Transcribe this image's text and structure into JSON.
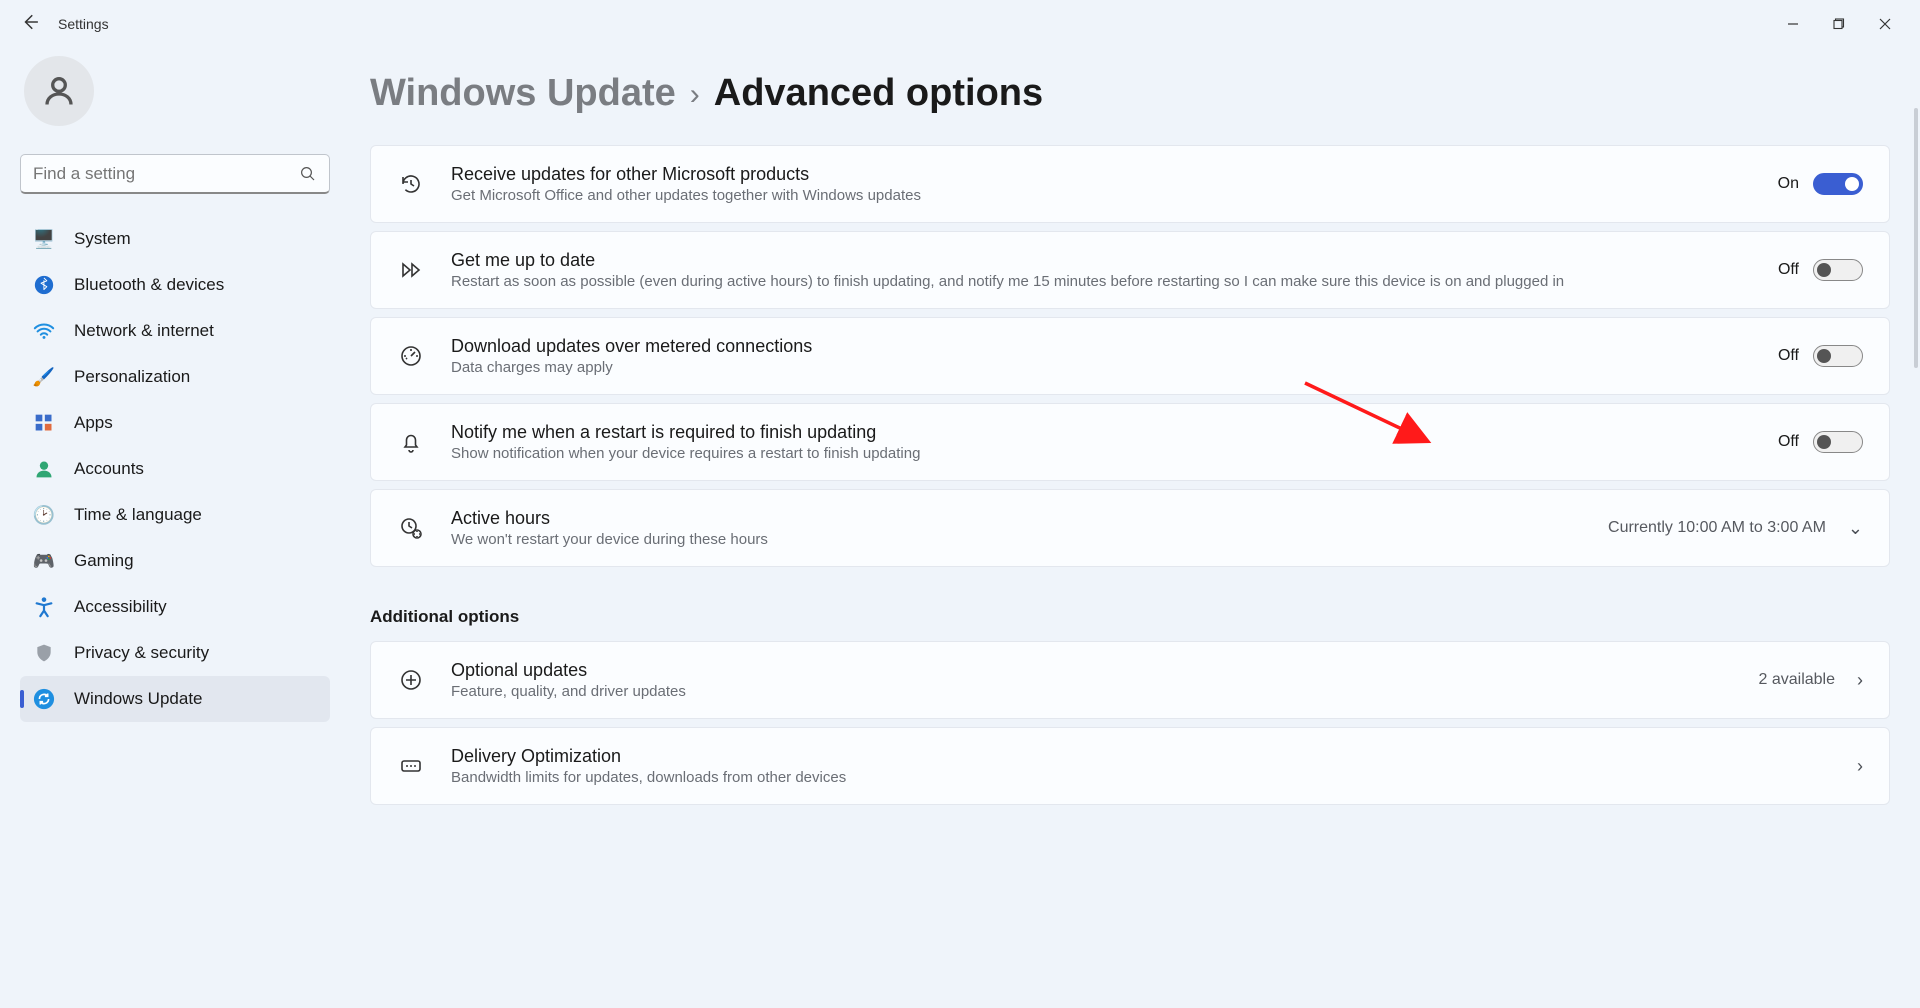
{
  "app": {
    "name": "Settings"
  },
  "search": {
    "placeholder": "Find a setting"
  },
  "sidebar": {
    "items": [
      {
        "label": "System"
      },
      {
        "label": "Bluetooth & devices"
      },
      {
        "label": "Network & internet"
      },
      {
        "label": "Personalization"
      },
      {
        "label": "Apps"
      },
      {
        "label": "Accounts"
      },
      {
        "label": "Time & language"
      },
      {
        "label": "Gaming"
      },
      {
        "label": "Accessibility"
      },
      {
        "label": "Privacy & security"
      },
      {
        "label": "Windows Update"
      }
    ]
  },
  "breadcrumb": {
    "parent": "Windows Update",
    "current": "Advanced options"
  },
  "settings": {
    "receive_other": {
      "title": "Receive updates for other Microsoft products",
      "sub": "Get Microsoft Office and other updates together with Windows updates",
      "state": "On"
    },
    "up_to_date": {
      "title": "Get me up to date",
      "sub": "Restart as soon as possible (even during active hours) to finish updating, and notify me 15 minutes before restarting so I can make sure this device is on and plugged in",
      "state": "Off"
    },
    "metered": {
      "title": "Download updates over metered connections",
      "sub": "Data charges may apply",
      "state": "Off"
    },
    "notify_restart": {
      "title": "Notify me when a restart is required to finish updating",
      "sub": "Show notification when your device requires a restart to finish updating",
      "state": "Off"
    },
    "active_hours": {
      "title": "Active hours",
      "sub": "We won't restart your device during these hours",
      "value": "Currently 10:00 AM to 3:00 AM"
    }
  },
  "additional": {
    "heading": "Additional options",
    "optional": {
      "title": "Optional updates",
      "sub": "Feature, quality, and driver updates",
      "value": "2 available"
    },
    "delivery": {
      "title": "Delivery Optimization",
      "sub": "Bandwidth limits for updates, downloads from other devices"
    }
  }
}
